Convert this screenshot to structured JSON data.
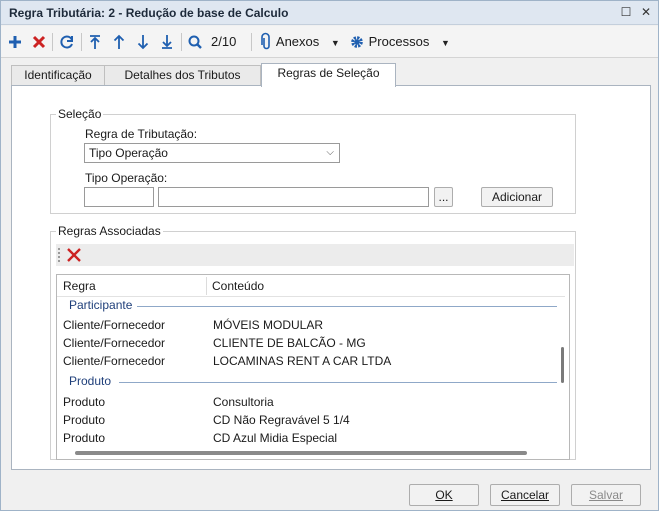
{
  "window": {
    "title": "Regra Tributária: 2 - Redução de base de Calculo",
    "maximize_glyph": "☐",
    "close_glyph": "✕"
  },
  "toolbar": {
    "record_position": "2/10",
    "anexos_label": "Anexos",
    "processos_label": "Processos",
    "icons": [
      "add-icon",
      "delete-icon",
      "refresh-icon",
      "first-icon",
      "previous-icon",
      "next-icon",
      "last-icon",
      "search-icon",
      "paperclip-icon",
      "gear-icon"
    ],
    "add_color": "#1f5fb0",
    "delete_color": "#cc2222"
  },
  "tabs": [
    {
      "label": "Identificação"
    },
    {
      "label": "Detalhes dos Tributos"
    },
    {
      "label": "Regras de Seleção",
      "active": true
    }
  ],
  "selecao": {
    "legend": "Seleção",
    "regra_label": "Regra de Tributação:",
    "regra_value": "Tipo Operação",
    "tipo_label": "Tipo Operação:",
    "tipo_code": "",
    "tipo_desc": "",
    "lookup_label": "...",
    "adicionar_label": "Adicionar"
  },
  "associadas": {
    "legend": "Regras Associadas",
    "columns": {
      "regra": "Regra",
      "conteudo": "Conteúdo"
    },
    "groups": [
      {
        "name": "Participante",
        "rows": [
          {
            "regra": "Cliente/Fornecedor",
            "conteudo": "MÓVEIS MODULAR"
          },
          {
            "regra": "Cliente/Fornecedor",
            "conteudo": "CLIENTE DE BALCÃO - MG"
          },
          {
            "regra": "Cliente/Fornecedor",
            "conteudo": "LOCAMINAS RENT A CAR LTDA"
          }
        ]
      },
      {
        "name": "Produto",
        "rows": [
          {
            "regra": "Produto",
            "conteudo": "Consultoria"
          },
          {
            "regra": "Produto",
            "conteudo": "CD Não Regravável 5 1/4"
          },
          {
            "regra": "Produto",
            "conteudo": "CD Azul Midia Especial"
          }
        ]
      }
    ]
  },
  "footer": {
    "ok_label": "OK",
    "cancelar_label": "Cancelar",
    "salvar_label": "Salvar"
  }
}
